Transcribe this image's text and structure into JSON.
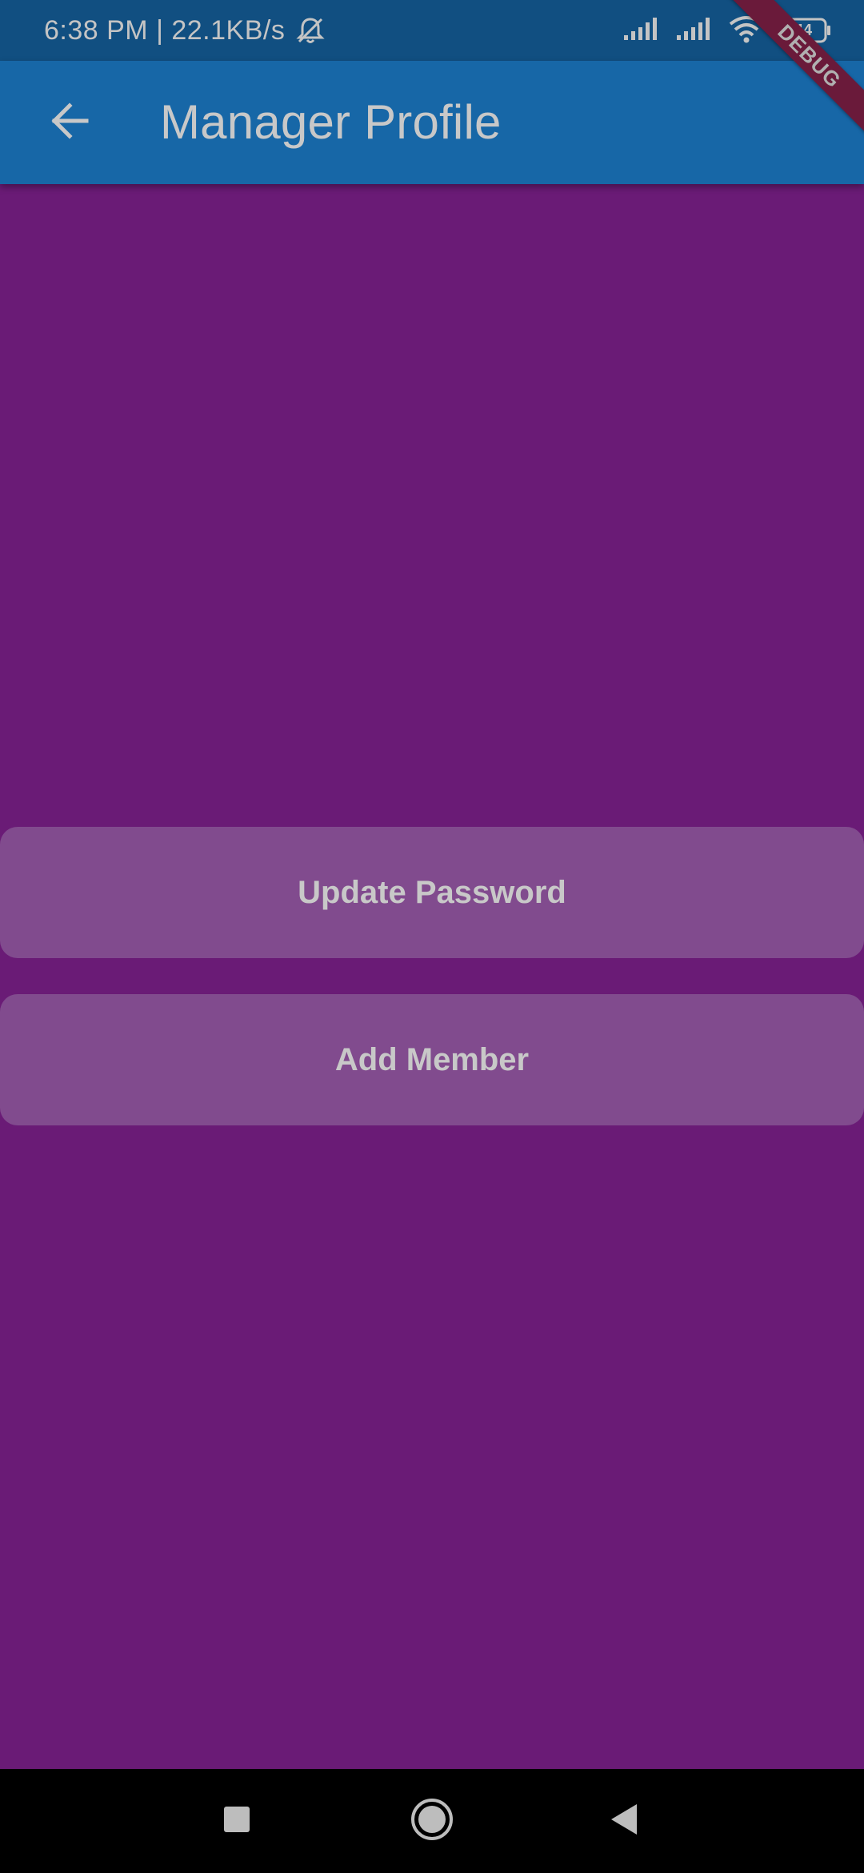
{
  "status_bar": {
    "time_speed": "6:38 PM | 22.1KB/s",
    "icons": [
      "dnd-off-icon",
      "signal-icon",
      "signal-icon",
      "wifi-icon",
      "battery-icon"
    ],
    "battery_level": "44"
  },
  "app_bar": {
    "title": "Manager Profile",
    "back_icon": "arrow-left-icon"
  },
  "debug_banner": {
    "label": "DEBUG"
  },
  "actions": {
    "update_password_label": "Update Password",
    "add_member_label": "Add Member"
  },
  "nav_bar": {
    "icons": [
      "recents-square-icon",
      "home-circle-icon",
      "back-triangle-icon"
    ]
  },
  "colors": {
    "background": "#6a1b76",
    "status_bar": "#114f81",
    "app_bar": "#1767a7",
    "button": "#814b8e",
    "debug_ribbon": "#6a1a3a"
  }
}
